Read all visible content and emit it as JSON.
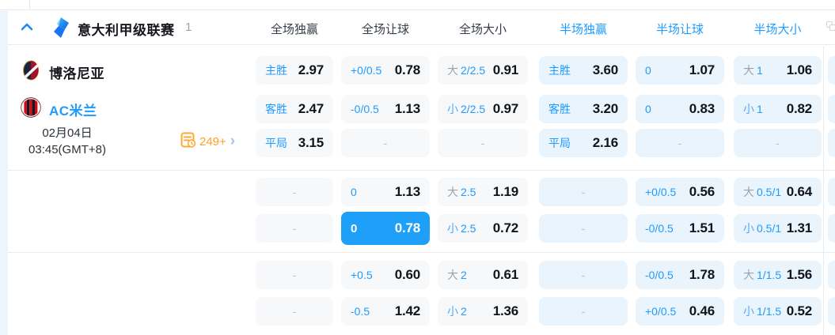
{
  "header": {
    "league_title": "意大利甲级联赛",
    "league_count": "1",
    "full_columns": [
      "全场独赢",
      "全场让球",
      "全场大小"
    ],
    "half_columns": [
      "半场独赢",
      "半场让球",
      "半场大小"
    ]
  },
  "match": {
    "home_team": "博洛尼亚",
    "away_team": "AC米兰",
    "date": "02月04日",
    "time": "03:45(GMT+8)",
    "markets_count": "249+",
    "more_arrow": "›"
  },
  "odds": {
    "dash": "-",
    "rows": [
      {
        "cells": [
          {
            "label": "主胜",
            "value": "2.97"
          },
          {
            "label": "+0/0.5",
            "value": "0.78"
          },
          {
            "prefix": "大",
            "label": "2/2.5",
            "value": "0.91"
          },
          {
            "label": "主胜",
            "value": "3.60"
          },
          {
            "label": "0",
            "value": "1.07"
          },
          {
            "prefix": "大",
            "label": "1",
            "value": "1.06"
          }
        ]
      },
      {
        "cells": [
          {
            "label": "客胜",
            "value": "2.47"
          },
          {
            "label": "-0/0.5",
            "value": "1.13"
          },
          {
            "prefix": "小",
            "label": "2/2.5",
            "value": "0.97"
          },
          {
            "label": "客胜",
            "value": "3.20"
          },
          {
            "label": "0",
            "value": "0.83"
          },
          {
            "prefix": "小",
            "label": "1",
            "value": "0.82"
          }
        ]
      },
      {
        "cells": [
          {
            "label": "平局",
            "value": "3.15"
          },
          {
            "dash": true
          },
          {
            "dash": true
          },
          {
            "label": "平局",
            "value": "2.16"
          },
          {
            "dash": true
          },
          {
            "dash": true
          }
        ]
      },
      {
        "cells": [
          {
            "dash": true
          },
          {
            "label": "0",
            "value": "1.13"
          },
          {
            "prefix": "大",
            "label": "2.5",
            "value": "1.19"
          },
          {
            "dash": true
          },
          {
            "label": "+0/0.5",
            "value": "0.56"
          },
          {
            "prefix": "大",
            "label": "0.5/1",
            "value": "0.64"
          }
        ]
      },
      {
        "cells": [
          {
            "dash": true
          },
          {
            "label": "0",
            "value": "0.78",
            "selected": true
          },
          {
            "prefix": "小",
            "label": "2.5",
            "value": "0.72"
          },
          {
            "dash": true
          },
          {
            "label": "-0/0.5",
            "value": "1.51"
          },
          {
            "prefix": "小",
            "label": "0.5/1",
            "value": "1.31"
          }
        ]
      },
      {
        "cells": [
          {
            "dash": true
          },
          {
            "label": "+0.5",
            "value": "0.60"
          },
          {
            "prefix": "大",
            "label": "2",
            "value": "0.61"
          },
          {
            "dash": true
          },
          {
            "label": "-0/0.5",
            "value": "1.78"
          },
          {
            "prefix": "大",
            "label": "1/1.5",
            "value": "1.56"
          }
        ]
      },
      {
        "cells": [
          {
            "dash": true
          },
          {
            "label": "-0.5",
            "value": "1.42"
          },
          {
            "prefix": "小",
            "label": "2",
            "value": "1.36"
          },
          {
            "dash": true
          },
          {
            "label": "+0/0.5",
            "value": "0.46"
          },
          {
            "prefix": "小",
            "label": "1/1.5",
            "value": "0.52"
          }
        ]
      }
    ]
  },
  "colors": {
    "accent_blue": "#1e9bff",
    "selected_cell_bg": "#1fa0f8",
    "full_cell_bg": "#f7f8fa",
    "half_cell_bg": "#e9f4fd",
    "orange": "#ff9e2c",
    "prefix_big_gray": "#9aa3ae",
    "prefix_small_blue": "#55a8f6"
  }
}
